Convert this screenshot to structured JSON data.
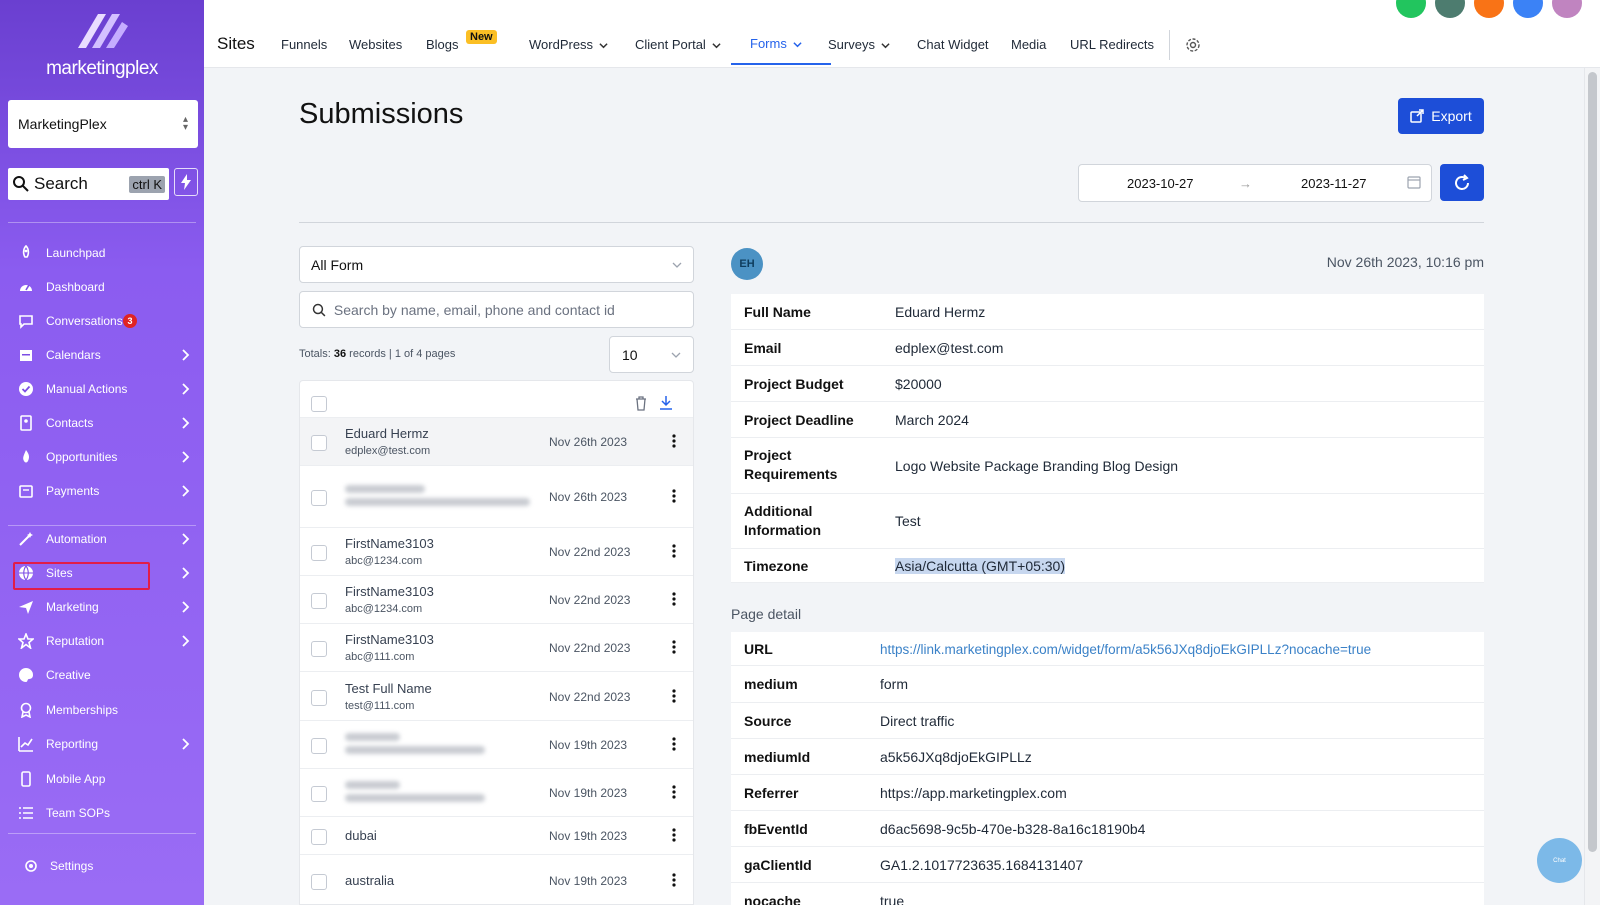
{
  "sidebar": {
    "logo_text": "marketingplex",
    "account": "MarketingPlex",
    "search_label": "Search",
    "search_shortcut": "ctrl K",
    "items": [
      {
        "label": "Launchpad",
        "icon": "rocket-icon",
        "chevron": false
      },
      {
        "label": "Dashboard",
        "icon": "gauge-icon",
        "chevron": false
      },
      {
        "label": "Conversations",
        "icon": "chat-icon",
        "chevron": false,
        "badge": "3"
      },
      {
        "label": "Calendars",
        "icon": "calendar-icon",
        "chevron": true
      },
      {
        "label": "Manual Actions",
        "icon": "check-circle-icon",
        "chevron": true
      },
      {
        "label": "Contacts",
        "icon": "contact-book-icon",
        "chevron": true
      },
      {
        "label": "Opportunities",
        "icon": "flame-icon",
        "chevron": true
      },
      {
        "label": "Payments",
        "icon": "payment-card-icon",
        "chevron": true
      },
      {
        "label": "Automation",
        "icon": "wand-icon",
        "chevron": true
      },
      {
        "label": "Sites",
        "icon": "globe-icon",
        "chevron": true
      },
      {
        "label": "Marketing",
        "icon": "send-icon",
        "chevron": true
      },
      {
        "label": "Reputation",
        "icon": "star-icon",
        "chevron": true
      },
      {
        "label": "Creative",
        "icon": "palette-icon",
        "chevron": false
      },
      {
        "label": "Memberships",
        "icon": "medal-icon",
        "chevron": false
      },
      {
        "label": "Reporting",
        "icon": "chart-line-icon",
        "chevron": true
      },
      {
        "label": "Mobile App",
        "icon": "phone-icon",
        "chevron": false
      },
      {
        "label": "Team SOPs",
        "icon": "list-icon",
        "chevron": false
      }
    ],
    "settings_label": "Settings"
  },
  "topnav": {
    "title": "Sites",
    "items": [
      "Funnels",
      "Websites",
      "Blogs",
      "WordPress",
      "Client Portal",
      "Forms",
      "Surveys",
      "Chat Widget",
      "Media",
      "URL Redirects"
    ],
    "new_badge": "New",
    "active": "Forms",
    "header_icon_colors": [
      "#22c55e",
      "#4d7c6f",
      "#f97316",
      "#3b82f6",
      "#c084c0"
    ]
  },
  "main": {
    "title": "Submissions",
    "export_label": "Export",
    "date_start": "2023-10-27",
    "date_end": "2023-11-27",
    "form_select": "All Form",
    "search_placeholder": "Search by name, email, phone and contact id",
    "totals_prefix": "Totals:",
    "totals_count": "36",
    "totals_suffix": "records | 1 of 4 pages",
    "per_page": "10"
  },
  "submissions": [
    {
      "name": "Eduard Hermz",
      "email": "edplex@test.com",
      "date": "Nov 26th 2023"
    },
    {
      "name": "",
      "email": "",
      "date": "Nov 26th 2023"
    },
    {
      "name": "FirstName3103",
      "email": "abc@1234.com",
      "date": "Nov 22nd 2023"
    },
    {
      "name": "FirstName3103",
      "email": "abc@1234.com",
      "date": "Nov 22nd 2023"
    },
    {
      "name": "FirstName3103",
      "email": "abc@111.com",
      "date": "Nov 22nd 2023"
    },
    {
      "name": "Test Full Name",
      "email": "test@111.com",
      "date": "Nov 22nd 2023"
    },
    {
      "name": "",
      "email": "",
      "date": "Nov 19th 2023"
    },
    {
      "name": "",
      "email": "",
      "date": "Nov 19th 2023"
    },
    {
      "name": "dubai",
      "email": "",
      "date": "Nov 19th 2023"
    },
    {
      "name": "australia",
      "email": "",
      "date": "Nov 19th 2023"
    }
  ],
  "detail": {
    "avatar_initials": "EH",
    "submitted_at": "Nov 26th 2023, 10:16 pm",
    "fields": [
      {
        "label": "Full Name",
        "value": "Eduard Hermz"
      },
      {
        "label": "Email",
        "value": "edplex@test.com"
      },
      {
        "label": "Project Budget",
        "value": "$20000"
      },
      {
        "label": "Project Deadline",
        "value": "March 2024"
      },
      {
        "label": "Project Requirements",
        "value": "Logo Website Package Branding Blog Design"
      },
      {
        "label": "Additional Information",
        "value": "Test"
      },
      {
        "label": "Timezone",
        "value": "Asia/Calcutta (GMT+05:30)"
      }
    ],
    "page_detail_title": "Page detail",
    "page_detail": [
      {
        "label": "URL",
        "value": "https://link.marketingplex.com/widget/form/a5k56JXq8djoEkGIPLLz?nocache=true"
      },
      {
        "label": "medium",
        "value": "form"
      },
      {
        "label": "Source",
        "value": "Direct traffic"
      },
      {
        "label": "mediumId",
        "value": "a5k56JXq8djoEkGIPLLz"
      },
      {
        "label": "Referrer",
        "value": "https://app.marketingplex.com"
      },
      {
        "label": "fbEventId",
        "value": "d6ac5698-9c5b-470e-b328-8a16c18190b4"
      },
      {
        "label": "gaClientId",
        "value": "GA1.2.1017723635.1684131407"
      },
      {
        "label": "nocache",
        "value": "true"
      }
    ]
  },
  "chat_widget_label": "Chat"
}
